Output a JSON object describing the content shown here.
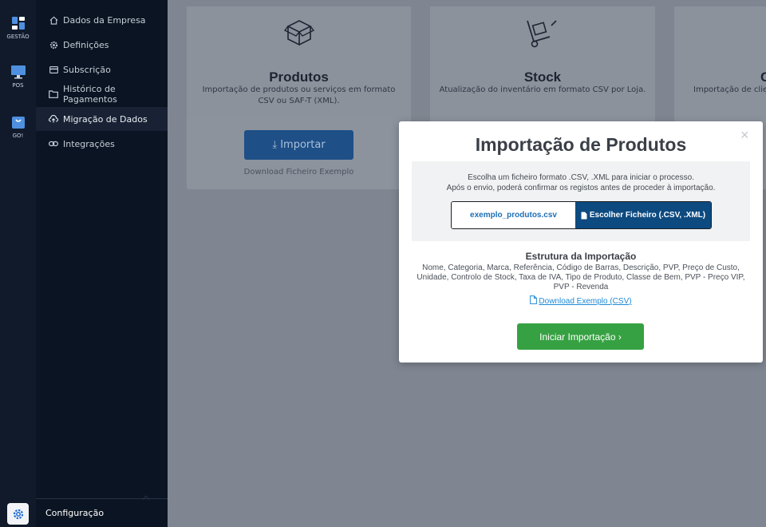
{
  "rail": {
    "items": [
      {
        "label": "GESTÃO",
        "icon": "dashboard-icon"
      },
      {
        "label": "POS",
        "icon": "monitor-icon"
      },
      {
        "label": "GO!",
        "icon": "shopping-bag-icon"
      }
    ],
    "settings_icon": "gear-icon"
  },
  "menu": {
    "items": [
      {
        "label": "Dados da Empresa",
        "icon": "home-icon"
      },
      {
        "label": "Definições",
        "icon": "cog-icon"
      },
      {
        "label": "Subscrição",
        "icon": "card-icon"
      },
      {
        "label": "Histórico de Pagamentos",
        "icon": "folder-icon"
      },
      {
        "label": "Migração de Dados",
        "icon": "cloud-upload-icon",
        "active": true
      },
      {
        "label": "Integrações",
        "icon": "link-icon"
      }
    ],
    "footer_label": "Configuração"
  },
  "cards": [
    {
      "title": "Produtos",
      "description": "Importação de produtos ou serviços em formato CSV ou SAF-T (XML).",
      "button": "⤓ Importar",
      "link": "Download Ficheiro Exemplo",
      "icon": "box-icon"
    },
    {
      "title": "Stock",
      "description": "Atualização do inventário em formato CSV por Loja.",
      "icon": "hand-truck-icon"
    },
    {
      "title": "C",
      "description": "Importação de clier",
      "icon": "clients-icon"
    }
  ],
  "modal": {
    "title": "Importação de Produtos",
    "close": "×",
    "instructions_line1": "Escolha um ficheiro formato .CSV, .XML para iniciar o processo.",
    "instructions_line2": "Após o envio, poderá confirmar os registos antes de proceder à importação.",
    "file_name": "exemplo_produtos.csv",
    "choose_button": "Escolher Ficheiro (.CSV, .XML)",
    "structure_title": "Estrutura da Importação",
    "structure_fields": "Nome, Categoria, Marca, Referência, Código de Barras, Descrição, PVP, Preço de Custo, Unidade, Controlo de Stock, Taxa de IVA, Tipo de Produto, Classe de Bem, PVP - Preço VIP, PVP - Revenda",
    "download_link": "Download Exemplo (CSV)",
    "start_button": "Iniciar Importação ›"
  },
  "colors": {
    "rail_bg": "#101a2b",
    "menu_bg": "#0b1422",
    "overlay_bg": "#7f8691",
    "primary_blue": "#0d4a80",
    "accent_green": "#36a142",
    "link_blue": "#1f8ad6"
  }
}
